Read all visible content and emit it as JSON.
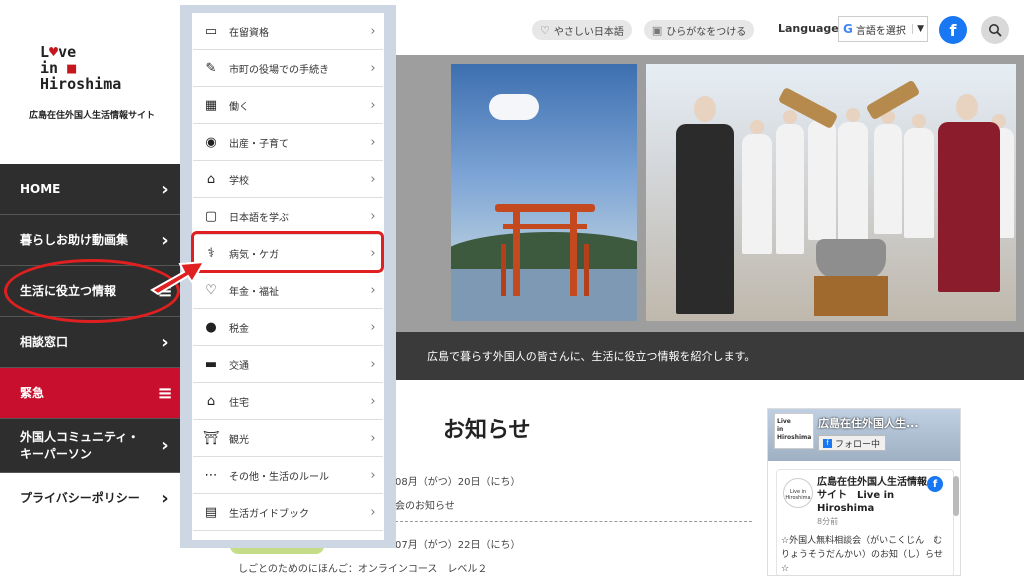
{
  "site": {
    "logo_line1": "L",
    "logo_line1b": "ve",
    "logo_line2": "in",
    "logo_line3": "Hiroshima",
    "subtitle": "広島在住外国人生活情報サイト"
  },
  "nav": {
    "items": [
      {
        "label": "HOME"
      },
      {
        "label": "暮らしお助け動画集"
      },
      {
        "label": "生活に役立つ情報"
      },
      {
        "label": "相談窓口"
      },
      {
        "label": "緊急"
      },
      {
        "label": "外国人コミュニティ・キーパーソン"
      },
      {
        "label": "プライバシーポリシー"
      }
    ]
  },
  "topbar": {
    "easy_japanese": "やさしい日本語",
    "furigana": "ひらがなをつける",
    "languages_label": "Languages",
    "select_language": "言語を選択"
  },
  "menu": {
    "items": [
      {
        "label": "在留資格",
        "icon": "id-card-icon"
      },
      {
        "label": "市町の役場での手続き",
        "icon": "form-icon"
      },
      {
        "label": "働く",
        "icon": "building-icon"
      },
      {
        "label": "出産・子育て",
        "icon": "pacifier-icon"
      },
      {
        "label": "学校",
        "icon": "school-icon"
      },
      {
        "label": "日本語を学ぶ",
        "icon": "chat-icon"
      },
      {
        "label": "病気・ケガ",
        "icon": "stethoscope-icon"
      },
      {
        "label": "年金・福祉",
        "icon": "care-hand-icon"
      },
      {
        "label": "税金",
        "icon": "coins-icon"
      },
      {
        "label": "交通",
        "icon": "car-icon"
      },
      {
        "label": "住宅",
        "icon": "house-icon"
      },
      {
        "label": "観光",
        "icon": "landmark-icon"
      },
      {
        "label": "その他・生活のルール",
        "icon": "more-icon"
      },
      {
        "label": "生活ガイドブック",
        "icon": "book-icon"
      }
    ]
  },
  "hero": {
    "caption": "広島で暮らす外国人の皆さんに、生活に役立つ情報を紹介します。"
  },
  "news": {
    "title": "お知らせ",
    "items": [
      {
        "date": "08月（がつ）20日（にち）",
        "text": "会のお知らせ"
      },
      {
        "date": "07月（がつ）22日（にち）",
        "text": "しごとのためのにほんご：オンラインコース　レベル２"
      }
    ]
  },
  "facebook_widget": {
    "page_name": "広島在住外国人生...",
    "follow": "フォロー中",
    "post_author": "広島在住外国人生活情報サイト　Live in Hiroshima",
    "post_time": "8分前",
    "post_text": "☆外国人無料相談会（がいこくじん　むりょうそうだんかい）のお知（し）らせ☆",
    "logo_text": "Live in Hiroshima"
  },
  "colors": {
    "nav_dark": "#2e2e2e",
    "nav_red": "#c8102e",
    "highlight": "#e02020",
    "facebook": "#1877f2"
  }
}
